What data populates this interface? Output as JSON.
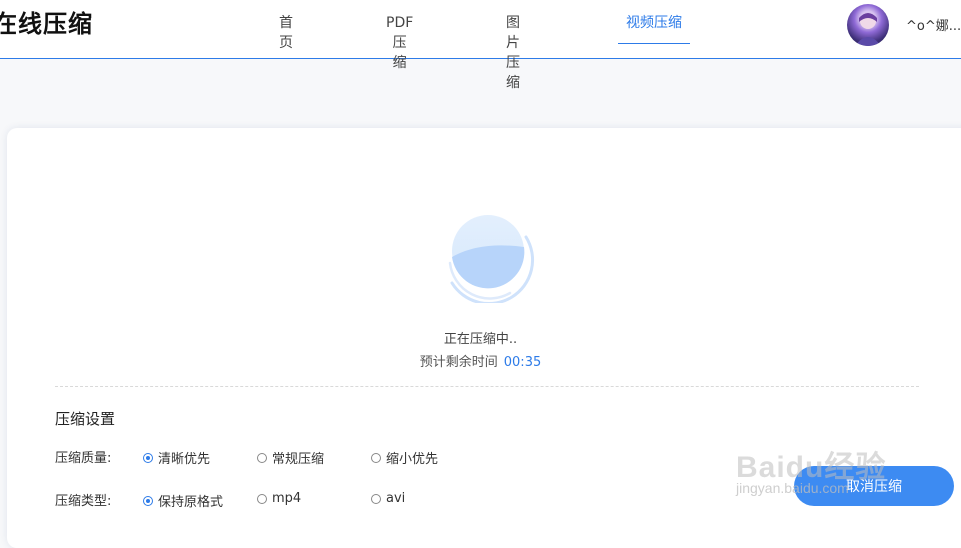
{
  "header": {
    "logo": "在线压缩",
    "nav": [
      {
        "label": "首页",
        "active": false
      },
      {
        "label": "PDF压缩",
        "active": false
      },
      {
        "label": "图片压缩",
        "active": false
      },
      {
        "label": "视频压缩",
        "active": true
      }
    ],
    "username": "^o^娜..."
  },
  "progress": {
    "status": "正在压缩中..",
    "eta_label": "预计剩余时间",
    "eta_value": "00:35"
  },
  "settings": {
    "title": "压缩设置",
    "quality": {
      "label": "压缩质量:",
      "options": [
        "清晰优先",
        "常规压缩",
        "缩小优先"
      ],
      "selected": "清晰优先"
    },
    "type": {
      "label": "压缩类型:",
      "options": [
        "保持原格式",
        "mp4",
        "avi"
      ],
      "selected": "保持原格式"
    }
  },
  "actions": {
    "cancel": "取消压缩"
  },
  "watermark": {
    "line1": "Baidu经验",
    "line2": "jingyan.baidu.com"
  },
  "colors": {
    "accent": "#2d7be8",
    "button": "#3d8bf2"
  }
}
